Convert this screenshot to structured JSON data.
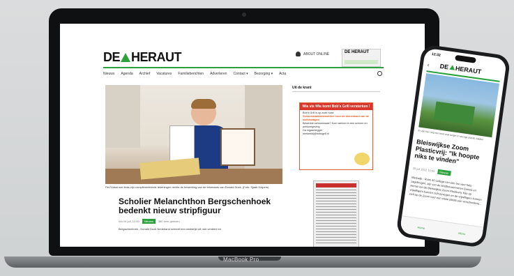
{
  "laptop": {
    "brand": "MacBook Pro"
  },
  "site": {
    "logo_left": "DE",
    "logo_right": "HERAUT",
    "account_label": "ABOUT ONLINE",
    "mini_paper_label": "DE HERAUT",
    "nav_items": [
      "Nieuws",
      "Agenda",
      "Archief",
      "Vacatures",
      "Familieberichten",
      "Adverteren",
      "Contact ▾",
      "Bezorging ▾",
      "Acta"
    ],
    "hero_caption": "Pet Vuisst met links zijn complimenteerde tekeningen rechts de bewerking van de tekenaars van Donald Duck. (Foto: Sjaak Kuipers)",
    "article_title": "Scholier Melanchthon Bergschenhoek bedenkt nieuw stripfiguur",
    "article_date": "Wo 04 juli, 12:00",
    "article_tag": "Nieuws",
    "article_views": "380 keer gelezen",
    "article_lead": "Bergschenhoek - Donald Duck Nederland schreef een wedstrijd uit: wie verdient en",
    "sidebar_title": "Uit de krant",
    "ad_title": "Wie vis Wie komt Bob's Grill versterken !",
    "ad_line1": "Bob's Grill is op zoek naar:",
    "ad_line2": "Schoonmaakmedewerker voor de binnenkant van de vuilniswagen",
    "ad_line3": "Bewerkte schoonmaak? Kom werken in een schone en werkomgeving",
    "ad_line4": "Ga ingaanlegger",
    "ad_line5": "werkenbij@bobsgrill.nl"
  },
  "phone": {
    "time": "12:32",
    "back_label": "‹",
    "logo_left": "DE",
    "logo_right": "HERAUT",
    "caption": "Er zijn hier nog een heel stuk lange en stevige plastic zakken",
    "title": "Bleiswijkse Zoom Plasticvrij: \"Ik hoopte niks te vinden\"",
    "meta_date": "25 juli 2022 10:00",
    "meta_tag": "Nieuws",
    "lead": "Bleiswijk - Ruim 40 collega van een trui voor fiets-zagebrugen, zijn van de landbouwervorren Erwina en Hernd van de Bleiswijkse Zoom Plasticvrij. Kilo op vrijwilligers kunnen zich opvegen en de vrijwilligers kunnen zich op de Zoom voor een vaste plaats een verscheidene...",
    "tab_home": "Home",
    "tab_menu": "Menu"
  }
}
